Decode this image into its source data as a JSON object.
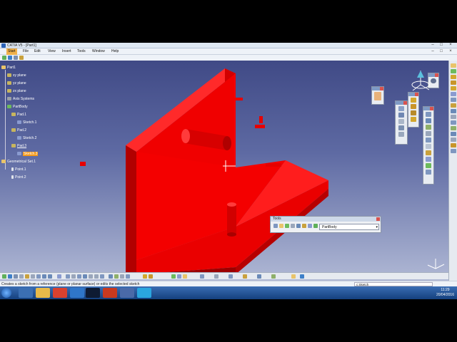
{
  "window": {
    "title": "CATIA V5 - [Part1]",
    "min": "–",
    "max": "□",
    "close": "×"
  },
  "menu": [
    "Start",
    "File",
    "Edit",
    "View",
    "Insert",
    "Tools",
    "Window",
    "Help"
  ],
  "tree": {
    "root": "Part1",
    "items": [
      {
        "label": "xy plane",
        "icon": "plane-icon"
      },
      {
        "label": "yz plane",
        "icon": "plane-icon"
      },
      {
        "label": "zx plane",
        "icon": "plane-icon"
      },
      {
        "label": "Axis Systems",
        "icon": "axis-system-icon"
      },
      {
        "label": "PartBody",
        "icon": "partbody-icon"
      },
      {
        "label": "Pad.1",
        "icon": "pad-icon"
      },
      {
        "label": "Sketch.1",
        "icon": "sketch-icon"
      },
      {
        "label": "Pad.2",
        "icon": "pad-icon"
      },
      {
        "label": "Sketch.2",
        "icon": "sketch-icon"
      },
      {
        "label": "Pad.3",
        "icon": "pad-icon"
      },
      {
        "label": "Sketch.3",
        "icon": "sketch-icon",
        "selected": true
      },
      {
        "label": "Geometrical Set.1",
        "icon": "geometrical-set-icon"
      },
      {
        "label": "Point.1",
        "icon": "point-icon"
      },
      {
        "label": "Point.2",
        "icon": "point-icon"
      }
    ]
  },
  "tools_toolbar": {
    "title": "Tools",
    "body_select": "PartBody",
    "arrow": "▾"
  },
  "compass_label": "",
  "status": {
    "message": "Creates a sketch from a reference (plane or planar surface) or edits the selected sketch",
    "command": "c:Sketch"
  },
  "clock": {
    "time": "11:29",
    "date": "20/04/2016"
  },
  "colors": {
    "model": "#e60000",
    "model_dark": "#a80000",
    "selected": "#f39a1c",
    "bg_top": "#404a86",
    "bg_bottom": "#b7bfd9"
  }
}
